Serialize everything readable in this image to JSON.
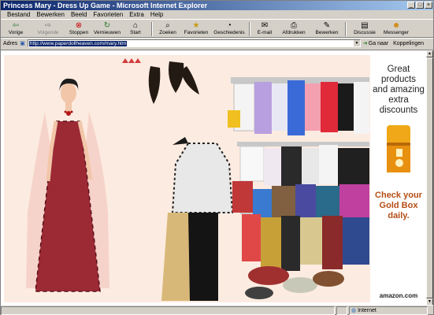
{
  "window": {
    "title": "Princess Mary - Dress Up Game - Microsoft Internet Explorer"
  },
  "menu": [
    "Bestand",
    "Bewerken",
    "Beeld",
    "Favorieten",
    "Extra",
    "Help"
  ],
  "toolbar": {
    "back": "Vorige",
    "forward": "Volgende",
    "stop": "Stoppen",
    "refresh": "Vernieuwen",
    "home": "Start",
    "search": "Zoeken",
    "favorites": "Favorieten",
    "history": "Geschiedenis",
    "mail": "E-mail",
    "print": "Afdrukken",
    "edit": "Bewerken",
    "discuss": "Discussie",
    "messenger": "Messenger"
  },
  "addressbar": {
    "label": "Adres",
    "url": "http://www.paperdollheaven.com/mary.htm",
    "go": "Ga naar",
    "links": "Koppelingen"
  },
  "ad": {
    "headline": "Great products and amazing extra discounts",
    "cta": "Check your Gold Box daily.",
    "brand": "amazon.com"
  },
  "status": {
    "zone": "Internet"
  },
  "colors": {
    "titlebar": "#0a246a",
    "game_background": "#fcebe0",
    "gown": "#9b2a35",
    "ad_cta": "#b54d14"
  }
}
